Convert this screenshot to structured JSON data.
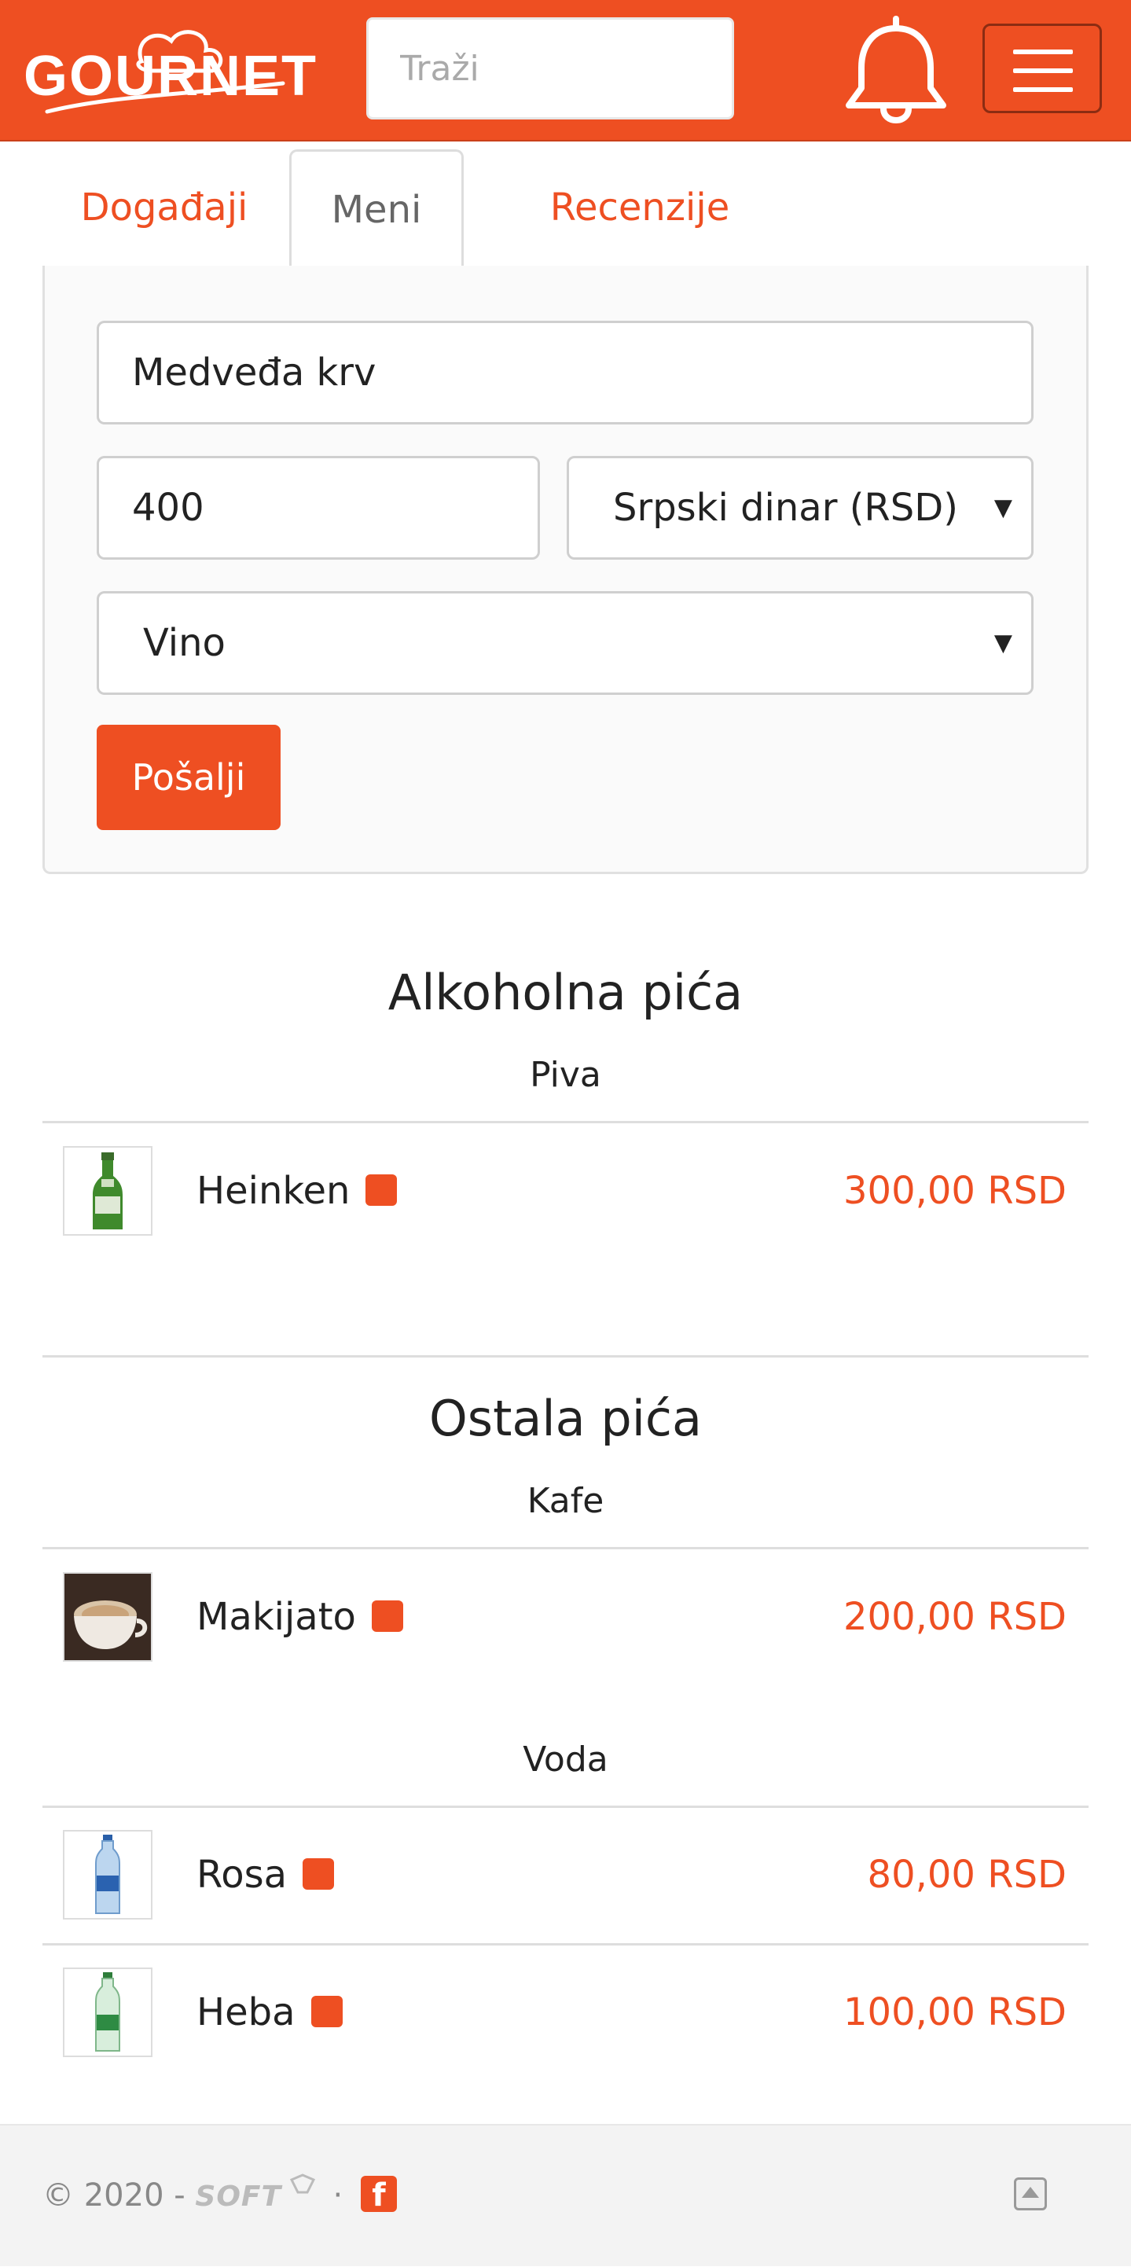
{
  "header": {
    "logo_text": "GOURNET",
    "search_placeholder": "Traži"
  },
  "tabs": [
    {
      "label": "Događaji",
      "active": false
    },
    {
      "label": "Meni",
      "active": true
    },
    {
      "label": "Recenzije",
      "active": false
    }
  ],
  "form": {
    "name_value": "Medveđa krv",
    "price_value": "400",
    "currency_selected": "Srpski dinar (RSD)",
    "category_selected": "Vino",
    "submit_label": "Pošalji"
  },
  "menu": [
    {
      "title": "Alkoholna pića",
      "groups": [
        {
          "name": "Piva",
          "items": [
            {
              "name": "Heinken",
              "price": "300,00 RSD",
              "image": "beer-bottle"
            }
          ]
        }
      ]
    },
    {
      "title": "Ostala pića",
      "groups": [
        {
          "name": "Kafe",
          "items": [
            {
              "name": "Makijato",
              "price": "200,00 RSD",
              "image": "coffee-cup"
            }
          ]
        },
        {
          "name": "Voda",
          "items": [
            {
              "name": "Rosa",
              "price": "80,00 RSD",
              "image": "water-bottle"
            },
            {
              "name": "Heba",
              "price": "100,00 RSD",
              "image": "water-bottle-green"
            }
          ]
        }
      ]
    }
  ],
  "footer": {
    "copyright": "© 2020 -",
    "brand": "SOFT",
    "separator": "·",
    "facebook_glyph": "f"
  },
  "colors": {
    "accent": "#ee4f22",
    "background": "#ffffff",
    "footer_bg": "#f3f3f3"
  }
}
